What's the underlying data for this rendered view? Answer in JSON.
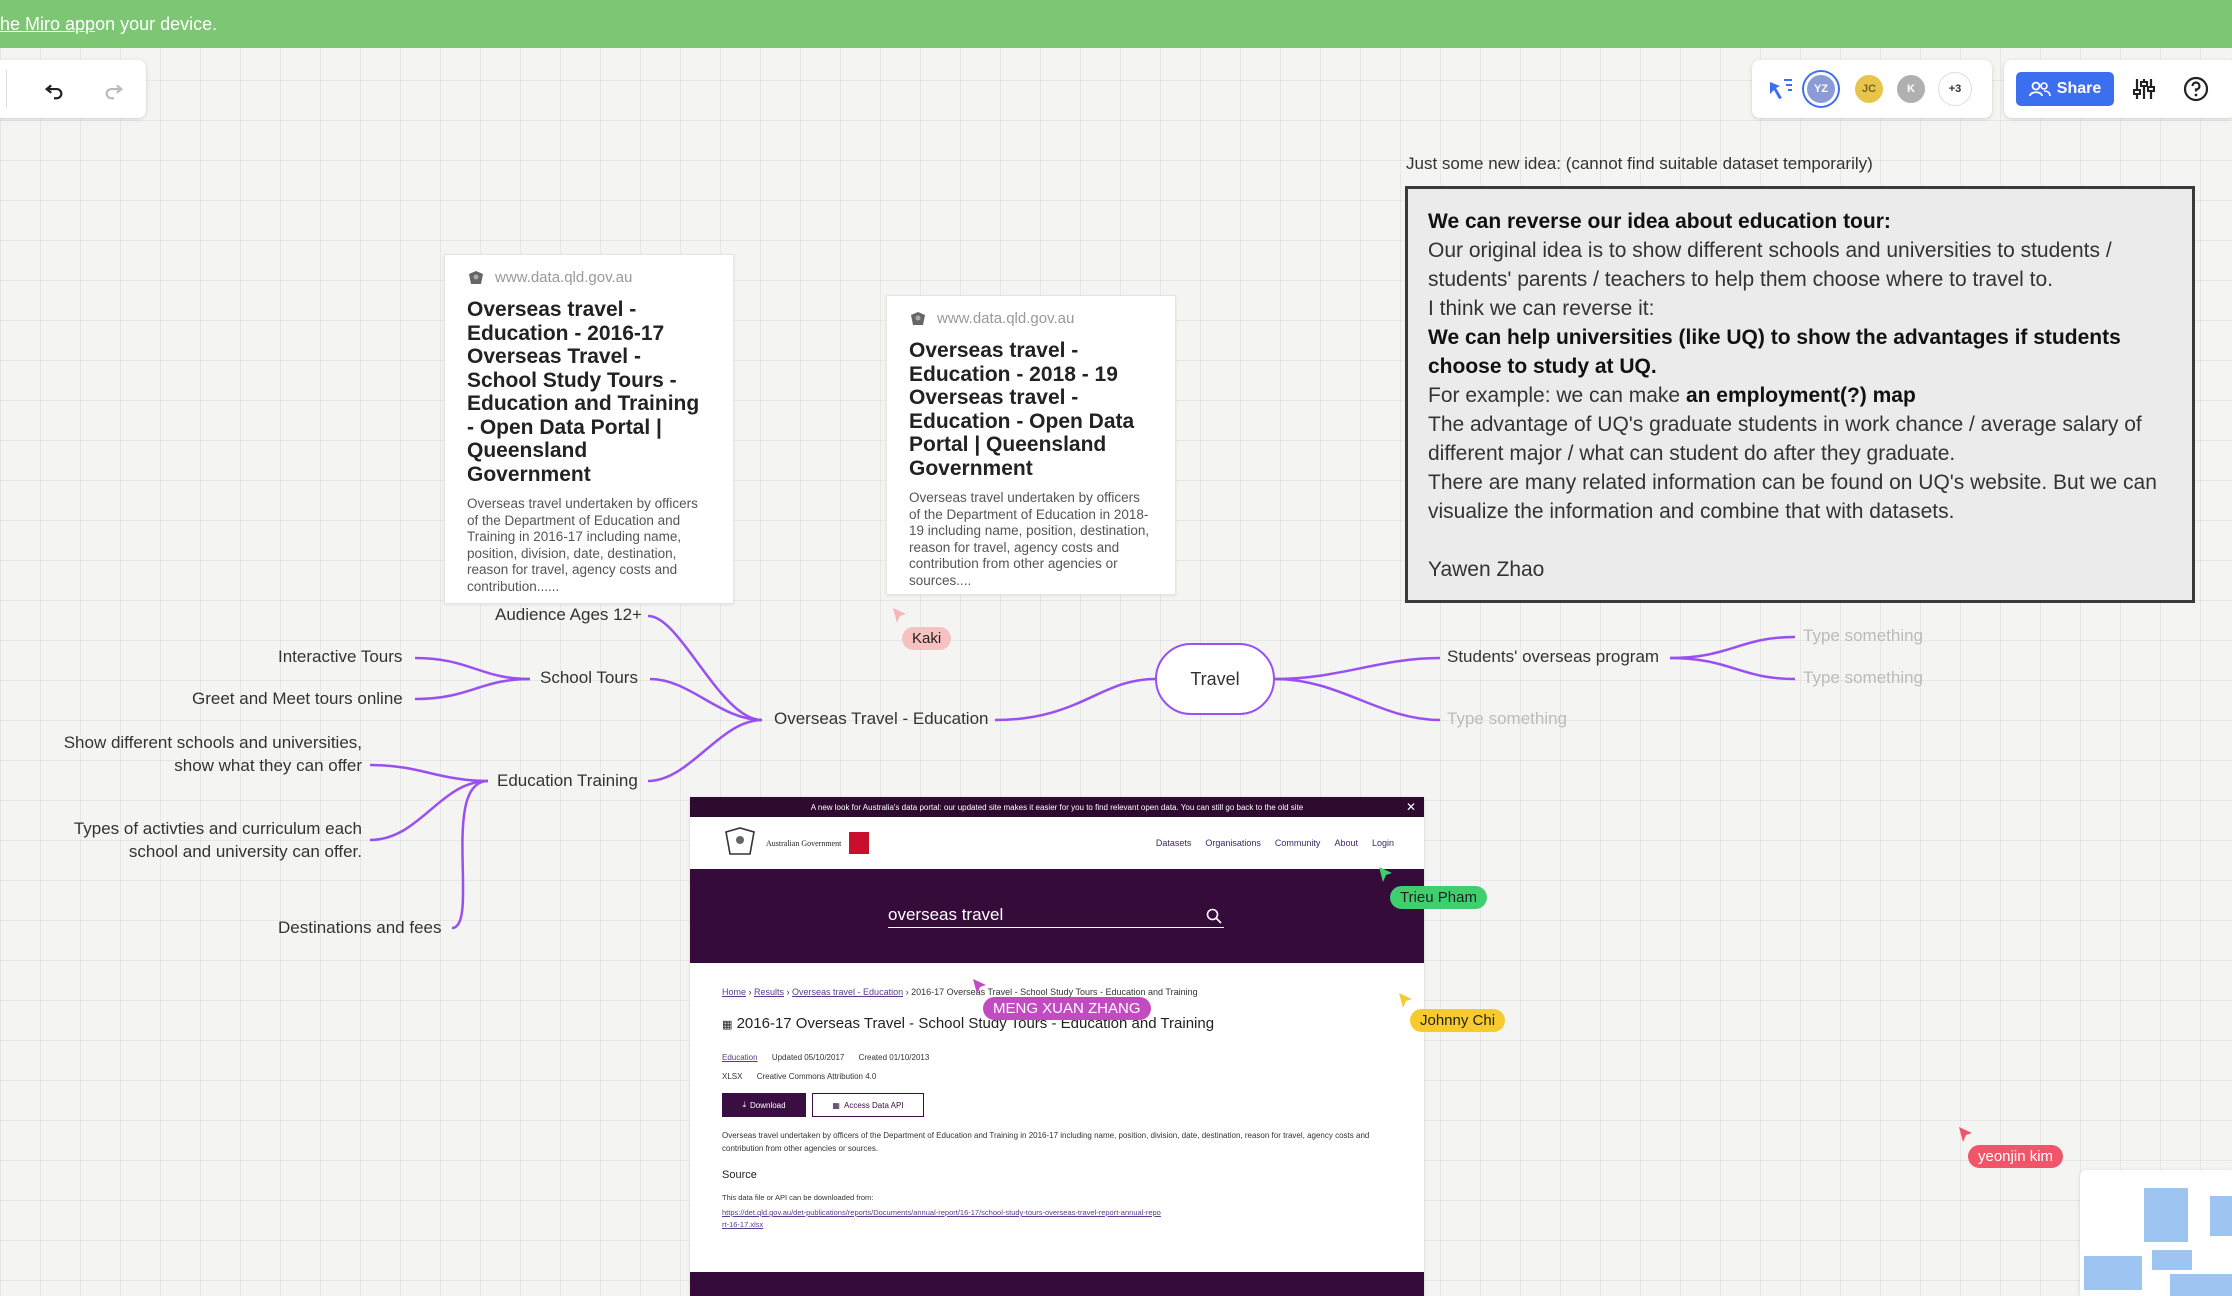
{
  "banner": {
    "link_text": "he Miro app",
    "text": " on your device."
  },
  "toolbar": {
    "undo": "undo-icon",
    "redo": "redo-icon"
  },
  "collaborators": {
    "avatars": [
      {
        "initials": "YZ",
        "color": "#8a9bd6"
      },
      {
        "initials": "JC",
        "color": "#e8c44a"
      },
      {
        "initials": "K",
        "color": "#b0b0b0"
      }
    ],
    "more": "+3"
  },
  "share": {
    "label": "Share"
  },
  "idea": {
    "caption": "Just some new idea: (cannot find suitable dataset temporarily)",
    "heading": "We can reverse our idea about education tour:",
    "p1": "Our original idea is to show different schools and universities to students / students' parents / teachers to help them choose where to travel to.",
    "p2": "I think we can reverse it:",
    "p3": "We can help universities (like UQ) to show the advantages if students choose to study at UQ.",
    "p4_pre": "For example: we can make ",
    "p4_bold": "an employment(?) map",
    "p5": "The advantage of UQ's graduate students in work chance / average salary of different major / what can student do after they graduate.",
    "p6": "There are many related information can be found on UQ's website. But we can visualize the information and combine that with datasets.",
    "author": "Yawen Zhao"
  },
  "cards": [
    {
      "source": "www.data.qld.gov.au",
      "title": "Overseas travel - Education - 2016-17 Overseas Travel - School Study Tours - Education and Training - Open Data Portal | Queensland Government",
      "desc": "Overseas travel undertaken by officers of the Department of Education and Training in 2016-17 including name, position, division, date, destination, reason for travel, agency costs and contribution......"
    },
    {
      "source": "www.data.qld.gov.au",
      "title": "Overseas travel - Education - 2018 - 19 Overseas travel - Education - Open Data Portal | Queensland Government",
      "desc": "Overseas travel undertaken by officers of the Department of Education in 2018-19 including name, position, destination, reason for travel, agency costs and contribution from other agencies or sources...."
    }
  ],
  "mindmap": {
    "audience": "Audience Ages 12+",
    "interactive": "Interactive Tours",
    "greet": "Greet and Meet tours online",
    "school_tours": "School Tours",
    "show_diff": "Show different schools and universities,",
    "show_diff2": "show what they can offer",
    "edu_training": "Education Training",
    "types1": "Types of activties and curriculum each",
    "types2": "school and university can offer.",
    "destinations": "Destinations and fees",
    "center": "Overseas Travel - Education",
    "travel": "Travel",
    "students_program": "Students' overseas program",
    "placeholder": "Type something"
  },
  "cursors": [
    {
      "name": "Kaki",
      "color": "#f7b6b6"
    },
    {
      "name": "Trieu Pham",
      "color": "#3fcf6e"
    },
    {
      "name": "MENG XUAN ZHANG",
      "color": "#c24bc2"
    },
    {
      "name": "Johnny Chi",
      "color": "#f7cb2e"
    },
    {
      "name": "yeonjin kim",
      "color": "#f0556a"
    }
  ],
  "embed": {
    "notice": "A new look for Australia's data portal: our updated site makes it easier for you to find relevant open data. You can still go back to the old site",
    "gov": "Australian Government",
    "nav": [
      "Datasets",
      "Organisations",
      "Community",
      "About",
      "Login"
    ],
    "search": "overseas travel",
    "crumbs": [
      "Home",
      "Results",
      "Overseas travel - Education"
    ],
    "crumb_last": "2016-17 Overseas Travel - School Study Tours - Education and Training",
    "title": "2016-17 Overseas Travel - School Study Tours - Education and Training",
    "tag": "Education",
    "updated": "Updated 05/10/2017",
    "created": "Created 01/10/2013",
    "format": "XLSX",
    "license": "Creative Commons Attribution 4.0",
    "download": "Download",
    "api": "Access Data API",
    "desc": "Overseas travel undertaken by officers of the Department of Education and Training in 2016-17 including name, position, division, date, destination, reason for travel, agency costs and contribution from other agencies or sources.",
    "source_h": "Source",
    "source_t": "This data file or API can be downloaded from:",
    "source_link": "https://det.qld.gov.au/det-publications/reports/Documents/annual-report/16-17/school-study-tours-overseas-travel-report-annual-report-16-17.xlsx"
  }
}
